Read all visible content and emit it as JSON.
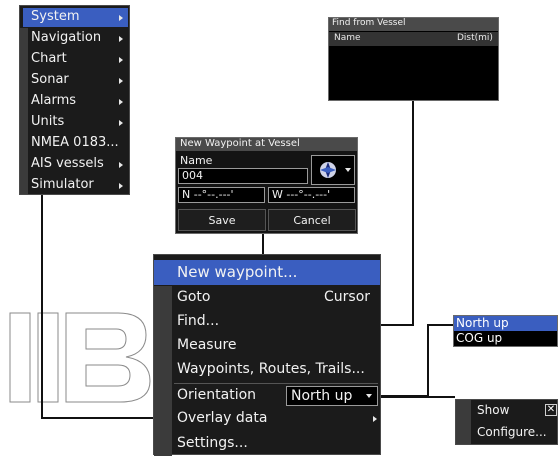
{
  "settings_menu": {
    "items": [
      {
        "label": "System",
        "submenu": true,
        "selected": true
      },
      {
        "label": "Navigation",
        "submenu": true
      },
      {
        "label": "Chart",
        "submenu": true
      },
      {
        "label": "Sonar",
        "submenu": true
      },
      {
        "label": "Alarms",
        "submenu": true
      },
      {
        "label": "Units",
        "submenu": true
      },
      {
        "label": "NMEA 0183...",
        "submenu": false
      },
      {
        "label": "AIS vessels",
        "submenu": true
      },
      {
        "label": "Simulator",
        "submenu": true
      }
    ]
  },
  "find_dialog": {
    "title": "Find from Vessel",
    "columns": [
      "Name",
      "Dist(mi)"
    ]
  },
  "waypoint_dialog": {
    "title": "New Waypoint at Vessel",
    "name_label": "Name",
    "name_value": "004",
    "lat_value": "N  --°--.---'",
    "lon_value": "W  ---°--.---'",
    "save_label": "Save",
    "cancel_label": "Cancel",
    "icon": "waypoint-symbol-icon"
  },
  "main_menu": {
    "items": [
      {
        "label": "New waypoint...",
        "selected": true
      },
      {
        "label": "Goto",
        "value": "Cursor"
      },
      {
        "label": "Find..."
      },
      {
        "label": "Measure"
      },
      {
        "label": "Waypoints, Routes, Trails..."
      },
      {
        "label": "Orientation",
        "value": "North up"
      },
      {
        "label": "Overlay data",
        "submenu": true
      },
      {
        "label": "Settings..."
      }
    ]
  },
  "orientation_dropdown": {
    "options": [
      {
        "label": "North up",
        "selected": true
      },
      {
        "label": "COG up",
        "selected": false
      }
    ]
  },
  "overlay_submenu": {
    "show_label": "Show",
    "configure_label": "Configure..."
  },
  "colors": {
    "highlight": "#3a5ec0",
    "menu_bg": "#1b1b1b",
    "wire": "#111111"
  }
}
